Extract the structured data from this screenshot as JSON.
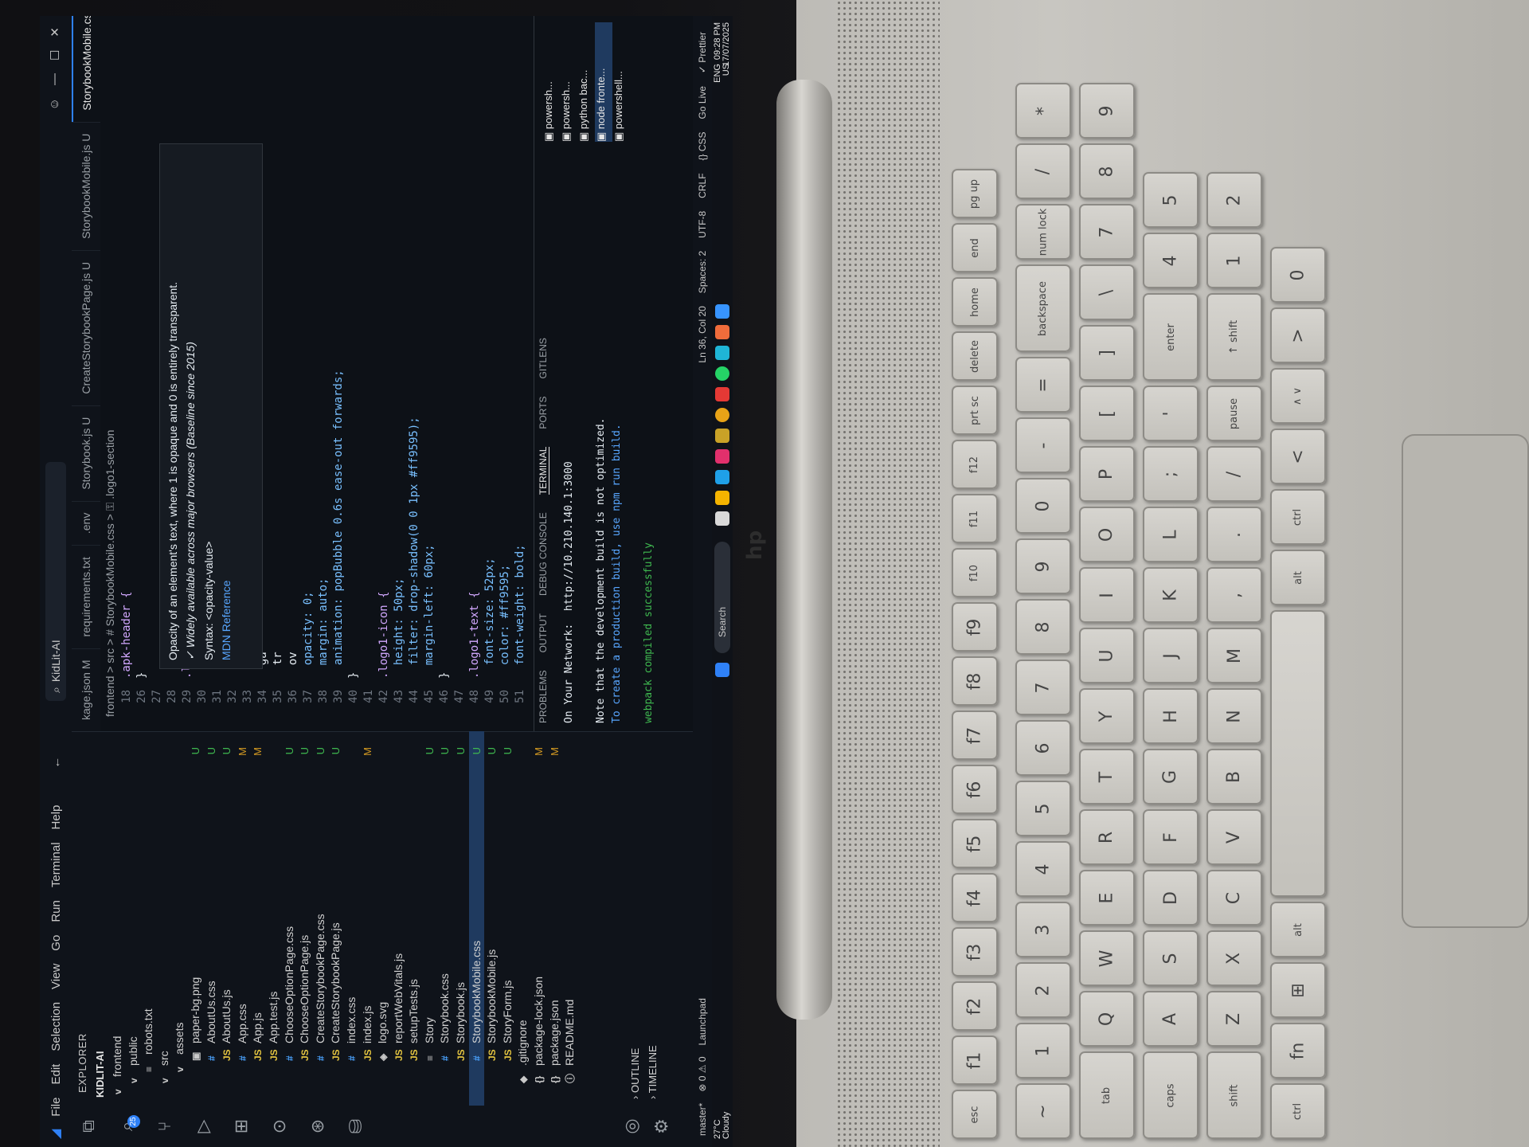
{
  "menu": [
    "File",
    "Edit",
    "Selection",
    "View",
    "Go",
    "Run",
    "Terminal",
    "Help"
  ],
  "command_center": "KidLit-AI",
  "explorer": {
    "title": "EXPLORER",
    "root": "KIDLIT-AI",
    "items": [
      {
        "label": "frontend",
        "icon": "v",
        "status": ""
      },
      {
        "label": "public",
        "icon": "v",
        "status": ""
      },
      {
        "label": "robots.txt",
        "icon": "≡",
        "status": ""
      },
      {
        "label": "src",
        "icon": "v",
        "status": ""
      },
      {
        "label": "assets",
        "icon": "v",
        "status": ""
      },
      {
        "label": "paper-bg.png",
        "icon": "▣",
        "status": "U"
      },
      {
        "label": "AboutUs.css",
        "icon": "#",
        "status": "U"
      },
      {
        "label": "AboutUs.js",
        "icon": "JS",
        "status": "U"
      },
      {
        "label": "App.css",
        "icon": "#",
        "status": "M"
      },
      {
        "label": "App.js",
        "icon": "JS",
        "status": "M"
      },
      {
        "label": "App.test.js",
        "icon": "JS",
        "status": ""
      },
      {
        "label": "ChooseOptionPage.css",
        "icon": "#",
        "status": "U"
      },
      {
        "label": "ChooseOptionPage.js",
        "icon": "JS",
        "status": "U"
      },
      {
        "label": "CreateStorybookPage.css",
        "icon": "#",
        "status": "U"
      },
      {
        "label": "CreateStorybookPage.js",
        "icon": "JS",
        "status": "U"
      },
      {
        "label": "index.css",
        "icon": "#",
        "status": ""
      },
      {
        "label": "index.js",
        "icon": "JS",
        "status": "M"
      },
      {
        "label": "logo.svg",
        "icon": "◈",
        "status": ""
      },
      {
        "label": "reportWebVitals.js",
        "icon": "JS",
        "status": ""
      },
      {
        "label": "setupTests.js",
        "icon": "JS",
        "status": ""
      },
      {
        "label": "Story",
        "icon": "≡",
        "status": "U"
      },
      {
        "label": "Storybook.css",
        "icon": "#",
        "status": "U"
      },
      {
        "label": "Storybook.js",
        "icon": "JS",
        "status": "U"
      },
      {
        "label": "StorybookMobile.css",
        "icon": "#",
        "status": "U"
      },
      {
        "label": "StorybookMobile.js",
        "icon": "JS",
        "status": "U"
      },
      {
        "label": "StoryForm.js",
        "icon": "JS",
        "status": "U"
      },
      {
        "label": ".gitignore",
        "icon": "◆",
        "status": ""
      },
      {
        "label": "package-lock.json",
        "icon": "{}",
        "status": "M"
      },
      {
        "label": "package.json",
        "icon": "{}",
        "status": "M"
      },
      {
        "label": "README.md",
        "icon": "ⓘ",
        "status": ""
      }
    ],
    "outline": "OUTLINE",
    "timeline": "TIMELINE"
  },
  "tabs": [
    {
      "label": "kage.json M"
    },
    {
      "label": "requirements.txt"
    },
    {
      "label": ".env"
    },
    {
      "label": "Storybook.js U"
    },
    {
      "label": "CreateStorybookPage.js U"
    },
    {
      "label": "StorybookMobile.js U"
    },
    {
      "label": "StorybookMobile.css U"
    }
  ],
  "breadcrumb": "frontend > src > # StorybookMobile.css > ⚿ .logo1-section",
  "code": [
    {
      "n": "18",
      "text": ".apk-header {"
    },
    {
      "n": "26",
      "text": "}"
    },
    {
      "n": "27",
      "text": ""
    },
    {
      "n": "28",
      "text": ""
    },
    {
      "n": "29",
      "text": ".logo1-section {"
    },
    {
      "n": "30",
      "text": "  display: flex;"
    },
    {
      "n": "31",
      "text": "  fl"
    },
    {
      "n": "32",
      "text": "  te"
    },
    {
      "n": "33",
      "text": "  al"
    },
    {
      "n": "34",
      "text": "  ga"
    },
    {
      "n": "35",
      "text": "  tr"
    },
    {
      "n": "36",
      "text": "  ov"
    },
    {
      "n": "37",
      "text": "  opacity: 0;"
    },
    {
      "n": "38",
      "text": "  margin: auto;"
    },
    {
      "n": "39",
      "text": "  animation: popBubble 0.6s ease-out forwards;"
    },
    {
      "n": "40",
      "text": "}"
    },
    {
      "n": "41",
      "text": ""
    },
    {
      "n": "42",
      "text": ".logo1-icon {"
    },
    {
      "n": "43",
      "text": "  height: 50px;"
    },
    {
      "n": "44",
      "text": "  filter: drop-shadow(0 0 1px #ff9595);"
    },
    {
      "n": "45",
      "text": "  margin-left: 60px;"
    },
    {
      "n": "46",
      "text": "}"
    },
    {
      "n": "47",
      "text": ""
    },
    {
      "n": "48",
      "text": ".logo1-text {"
    },
    {
      "n": "49",
      "text": "  font-size: 52px;"
    },
    {
      "n": "50",
      "text": "  color: #ff9595;"
    },
    {
      "n": "51",
      "text": "  font-weight: bold;"
    }
  ],
  "hover_doc": {
    "line1": "Opacity of an element's text, where 1 is opaque and 0 is entirely transparent.",
    "line2": "✓ Widely available across major browsers (Baseline since 2015)",
    "line3": "Syntax: <opacity-value>",
    "line4": "MDN Reference"
  },
  "panel": {
    "tabs": [
      "PROBLEMS",
      "OUTPUT",
      "DEBUG CONSOLE",
      "TERMINAL",
      "PORTS",
      "GITLENS"
    ],
    "terminal_lines": [
      "On Your Network:  http://10.210.140.1:3000",
      "",
      "Note that the development build is not optimized.",
      "To create a production build, use npm run build.",
      "",
      "webpack compiled successfully"
    ],
    "terminal_list": [
      "powersh...",
      "powersh...",
      "python bac...",
      "node fronte...",
      "powershell..."
    ]
  },
  "statusbar": {
    "left": [
      "master*",
      "⊗ 0 ⚠ 0",
      "Launchpad"
    ],
    "right": [
      "Ln 36, Col 20",
      "Spaces: 2",
      "UTF-8",
      "CRLF",
      "{} CSS",
      "Go Live",
      "✓ Prettier"
    ]
  },
  "taskbar": {
    "weather_temp": "27°C",
    "weather_desc": "Cloudy",
    "search": "Search",
    "tray_lang": "ENG",
    "tray_region": "US",
    "time": "09:28 PM",
    "date": "17/07/2025"
  },
  "keyboard": {
    "rows": [
      [
        "esc",
        "f1",
        "f2",
        "f3",
        "f4",
        "f5",
        "f6",
        "f7",
        "f8",
        "f9",
        "f10",
        "f11",
        "f12",
        "prt sc",
        "delete",
        "home",
        "end",
        "pg up"
      ],
      [
        "~",
        "1",
        "2",
        "3",
        "4",
        "5",
        "6",
        "7",
        "8",
        "9",
        "0",
        "-",
        "=",
        "backspace",
        "num lock",
        "/",
        "*"
      ],
      [
        "tab",
        "Q",
        "W",
        "E",
        "R",
        "T",
        "Y",
        "U",
        "I",
        "O",
        "P",
        "[",
        "]",
        "\\",
        "7",
        "8",
        "9"
      ],
      [
        "caps",
        "A",
        "S",
        "D",
        "F",
        "G",
        "H",
        "J",
        "K",
        "L",
        ";",
        "'",
        "enter",
        "4",
        "5"
      ],
      [
        "shift",
        "Z",
        "X",
        "C",
        "V",
        "B",
        "N",
        "M",
        ",",
        ".",
        "/",
        "pause",
        "↑ shift",
        "1",
        "2"
      ],
      [
        "ctrl",
        "fn",
        "⊞",
        "alt",
        "",
        "alt",
        "ctrl",
        "<",
        "∧ ∨",
        ">",
        "0"
      ]
    ]
  },
  "brand": "hp"
}
